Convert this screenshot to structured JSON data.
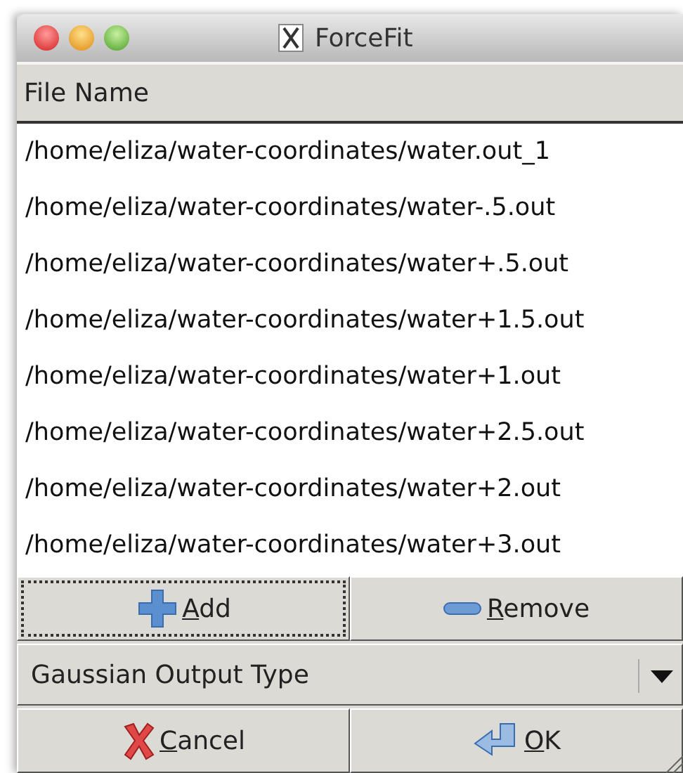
{
  "window": {
    "title": "ForceFit"
  },
  "table": {
    "columns": [
      "File Name"
    ],
    "rows": [
      "/home/eliza/water-coordinates/water.out_1",
      "/home/eliza/water-coordinates/water-.5.out",
      "/home/eliza/water-coordinates/water+.5.out",
      "/home/eliza/water-coordinates/water+1.5.out",
      "/home/eliza/water-coordinates/water+1.out",
      "/home/eliza/water-coordinates/water+2.5.out",
      "/home/eliza/water-coordinates/water+2.out",
      "/home/eliza/water-coordinates/water+3.out"
    ]
  },
  "list_buttons": [
    {
      "label": "Add",
      "kind": "add",
      "focused": true
    },
    {
      "label": "Remove",
      "kind": "remove",
      "focused": false
    }
  ],
  "output_type": {
    "value": "Gaussian Output Type"
  },
  "dialog_buttons": [
    {
      "label": "Cancel",
      "kind": "cancel"
    },
    {
      "label": "OK",
      "kind": "ok"
    }
  ]
}
